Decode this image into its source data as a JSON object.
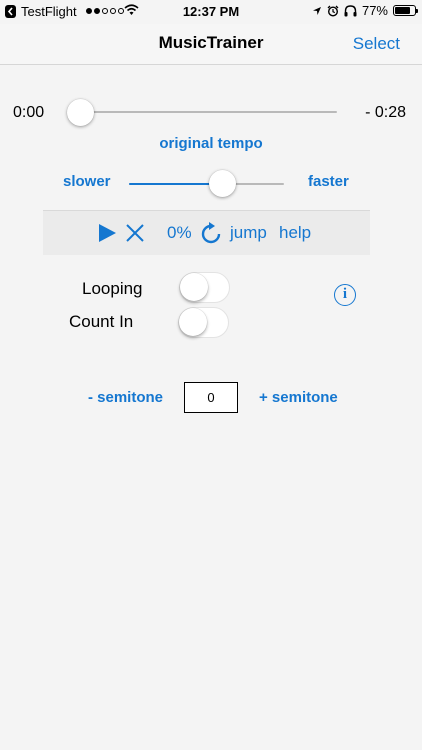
{
  "status_bar": {
    "app_name": "TestFlight",
    "time": "12:37 PM",
    "battery_percent": "77%",
    "battery_level": 0.77,
    "signal_bars_filled": 2,
    "signal_bars_total": 5
  },
  "nav": {
    "title": "MusicTrainer",
    "select_label": "Select"
  },
  "playback": {
    "elapsed": "0:00",
    "remaining": "- 0:28",
    "position": 0.0
  },
  "tempo": {
    "label": "original tempo",
    "slower_label": "slower",
    "faster_label": "faster",
    "level": 0.6
  },
  "controls": {
    "percent": "0%",
    "jump_label": "jump",
    "help_label": "help"
  },
  "toggles": {
    "looping_label": "Looping",
    "looping_on": false,
    "count_in_label": "Count In",
    "count_in_on": false
  },
  "pitch": {
    "minus_label": "- semitone",
    "plus_label": "+ semitone",
    "value": "0"
  },
  "colors": {
    "accent": "#1577d0",
    "background": "#f4f4f4"
  },
  "icons": [
    "back-icon",
    "wifi-icon",
    "location-icon",
    "alarm-icon",
    "headphones-icon",
    "battery-icon",
    "play-icon",
    "close-icon",
    "refresh-icon",
    "info-icon"
  ]
}
